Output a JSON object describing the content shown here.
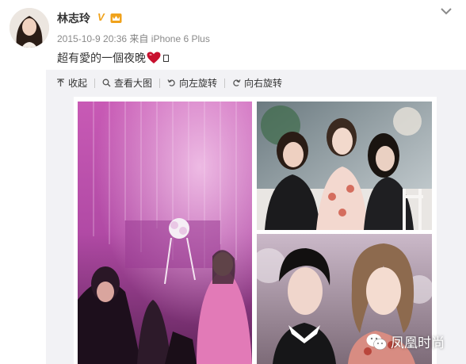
{
  "post": {
    "username": "林志玲",
    "verified_badge": "V",
    "timestamp": "2015-10-9 20:36",
    "source_prefix": "来自",
    "source_device": "iPhone 6 Plus",
    "text": "超有愛的一個夜晚"
  },
  "toolbar": {
    "collapse": "收起",
    "view_large": "查看大图",
    "rotate_left": "向左旋转",
    "rotate_right": "向右旋转"
  },
  "watermark": {
    "text": "凤凰时尚"
  },
  "colors": {
    "badge": "#f0a21b",
    "heart": "#c8102e",
    "photo_pink": "#c24fb0",
    "toolbar_bg": "#f2f2f5"
  }
}
